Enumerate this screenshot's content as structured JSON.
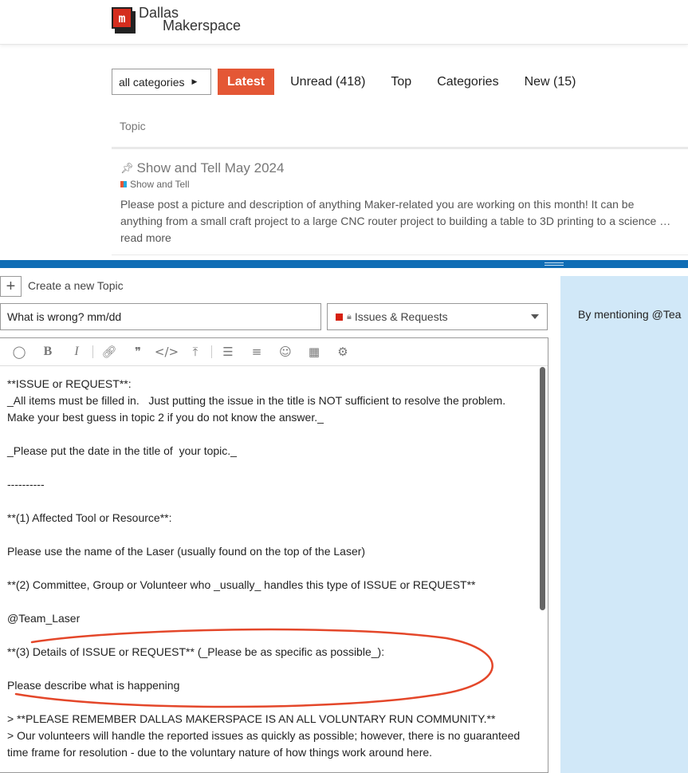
{
  "site": {
    "name_line1": "Dallas",
    "name_line2": "Makerspace",
    "logo_letter": "m"
  },
  "nav": {
    "category_dropdown": "all categories",
    "items": [
      "Latest",
      "Unread (418)",
      "Top",
      "Categories",
      "New (15)"
    ],
    "active": "Latest"
  },
  "topic_list": {
    "column_header": "Topic",
    "topic": {
      "title": "Show and Tell May 2024",
      "category": "Show and Tell",
      "excerpt": "Please post a picture and description of anything Maker-related you are working on this month! It can be anything from a small craft project to a large CNC router project to building a table to 3D printing to a science … read more"
    }
  },
  "composer": {
    "action_label": "Create a new Topic",
    "title_value": "What is wrong? mm/dd",
    "category": "Issues & Requests",
    "body_lines": [
      "**ISSUE or REQUEST**:",
      "_All items must be filled in.   Just putting the issue in the title is NOT sufficient to resolve the problem.  Make your best guess in topic 2 if you do not know the answer._",
      "",
      "_Please put the date in the title of  your topic._",
      "",
      "----------",
      "",
      "**(1) Affected Tool or Resource**:",
      "",
      "Please use the name of the Laser (usually found on the top of the Laser)",
      "",
      "**(2) Committee, Group or Volunteer who _usually_ handles this type of ISSUE or REQUEST**",
      "",
      "@Team_Laser",
      "",
      "**(3) Details of ISSUE or REQUEST** (_Please be as specific as possible_):",
      "",
      "Please describe what is happening",
      "",
      "> **PLEASE REMEMBER DALLAS MAKERSPACE IS AN ALL VOLUNTARY RUN COMMUNITY.**",
      "> Our volunteers will handle the reported issues as quickly as possible; however, there is no guaranteed time frame for resolution - due to the voluntary nature of how things work around here."
    ],
    "preview_text": "By mentioning @Tea"
  },
  "colors": {
    "accent": "#e45735",
    "composer_bar": "#0f6db5",
    "preview_bg": "#d1e8f8",
    "annotation": "#e4472a"
  }
}
